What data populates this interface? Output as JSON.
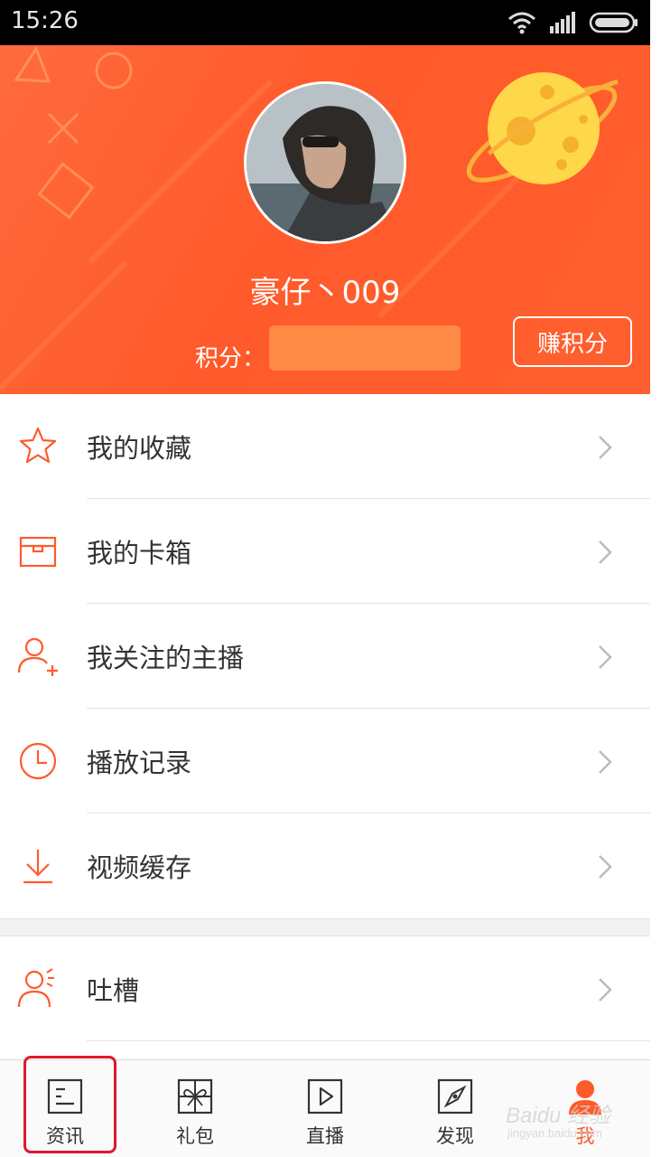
{
  "status_bar": {
    "time": "15:26",
    "icons": [
      "wifi-icon",
      "signal-icon",
      "battery-icon"
    ]
  },
  "profile": {
    "username": "豪仔丶009",
    "points_label": "积分：",
    "earn_button_label": "赚积分",
    "accent_color": "#ff5a2b"
  },
  "menu": {
    "items": [
      {
        "label": "我的收藏",
        "icon": "star-icon"
      },
      {
        "label": "我的卡箱",
        "icon": "box-icon"
      },
      {
        "label": "我关注的主播",
        "icon": "follow-user-icon"
      },
      {
        "label": "播放记录",
        "icon": "clock-icon"
      },
      {
        "label": "视频缓存",
        "icon": "download-icon"
      }
    ],
    "secondary_items": [
      {
        "label": "吐槽",
        "icon": "feedback-user-icon"
      }
    ]
  },
  "bottom_nav": {
    "items": [
      {
        "label": "资讯",
        "icon": "news-icon"
      },
      {
        "label": "礼包",
        "icon": "gift-icon"
      },
      {
        "label": "直播",
        "icon": "play-icon"
      },
      {
        "label": "发现",
        "icon": "compass-icon"
      },
      {
        "label": "我",
        "icon": "me-icon",
        "active": true
      }
    ]
  },
  "watermark": {
    "text": "Baidu 经验",
    "sub": "jingyan.baidu.com"
  }
}
